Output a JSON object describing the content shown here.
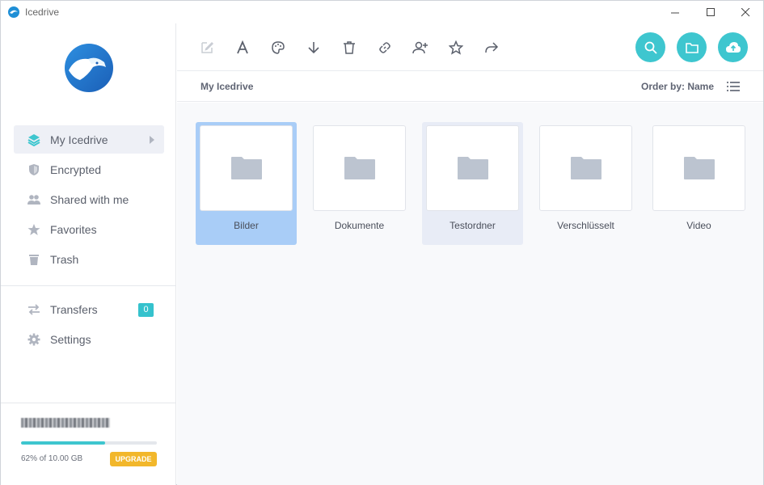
{
  "window": {
    "title": "Icedrive"
  },
  "sidebar": {
    "nav": [
      {
        "label": "My Icedrive",
        "icon": "layers-icon",
        "active": true
      },
      {
        "label": "Encrypted",
        "icon": "shield-icon"
      },
      {
        "label": "Shared with me",
        "icon": "users-icon"
      },
      {
        "label": "Favorites",
        "icon": "star-icon"
      },
      {
        "label": "Trash",
        "icon": "trash-icon"
      }
    ],
    "nav2": [
      {
        "label": "Transfers",
        "icon": "transfer-icon",
        "badge": "0"
      },
      {
        "label": "Settings",
        "icon": "gear-icon"
      }
    ],
    "storage": {
      "used_fraction": 0.62,
      "text": "62% of 10.00 GB",
      "upgrade_label": "UPGRADE"
    }
  },
  "toolbar": {
    "tools": [
      "edit-icon",
      "rename-icon",
      "palette-icon",
      "download-icon",
      "delete-icon",
      "link-icon",
      "add-user-icon",
      "favorite-icon",
      "share-icon"
    ],
    "actions": [
      "search-icon",
      "new-folder-icon",
      "upload-icon"
    ]
  },
  "pathbar": {
    "breadcrumb": "My Icedrive",
    "order_by": "Order by: Name"
  },
  "folders": [
    {
      "name": "Bilder",
      "state": "selected"
    },
    {
      "name": "Dokumente",
      "state": "normal"
    },
    {
      "name": "Testordner",
      "state": "hover"
    },
    {
      "name": "Verschlüsselt",
      "state": "normal"
    },
    {
      "name": "Video",
      "state": "normal"
    }
  ],
  "colors": {
    "accent": "#3ec6cf",
    "selected": "#a9cdf7",
    "upgrade": "#f2b72b",
    "folder": "#bcc4d0"
  }
}
